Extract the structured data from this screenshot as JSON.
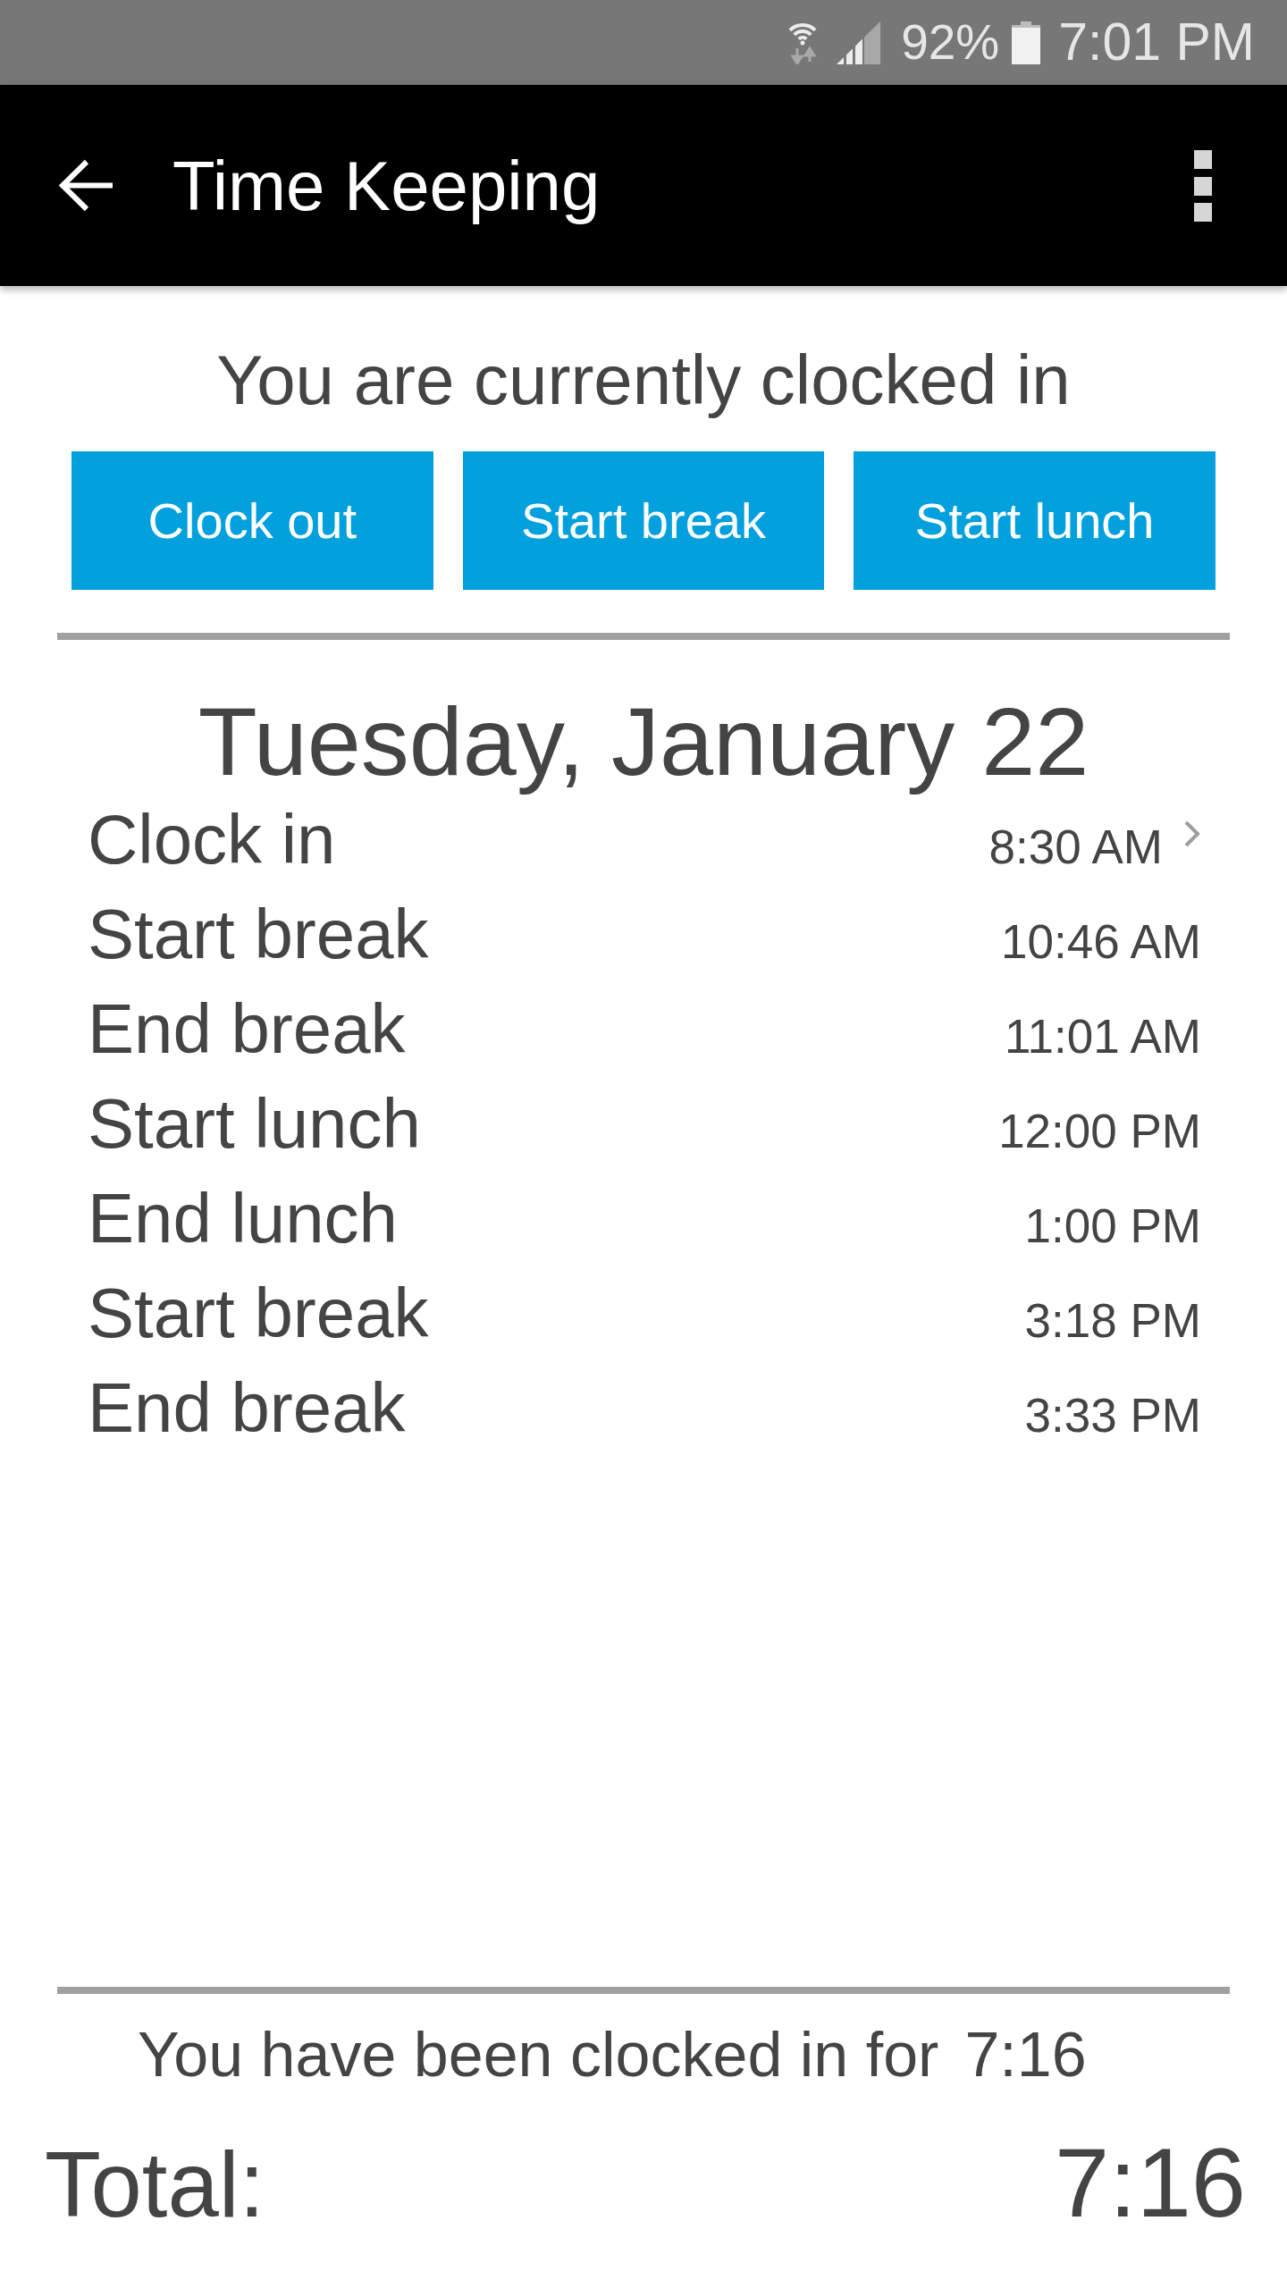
{
  "status_bar": {
    "battery": "92%",
    "time": "7:01 PM"
  },
  "app_bar": {
    "title": "Time Keeping"
  },
  "status_message": "You are currently clocked in",
  "actions": [
    {
      "label": "Clock out"
    },
    {
      "label": "Start break"
    },
    {
      "label": "Start lunch"
    }
  ],
  "day": {
    "title": "Tuesday, January 22",
    "entries": [
      {
        "label": "Clock in",
        "time": "8:30 AM",
        "disclosure": true
      },
      {
        "label": "Start break",
        "time": "10:46 AM",
        "disclosure": false
      },
      {
        "label": "End break",
        "time": "11:01 AM",
        "disclosure": false
      },
      {
        "label": "Start lunch",
        "time": "12:00 PM",
        "disclosure": false
      },
      {
        "label": "End lunch",
        "time": "1:00 PM",
        "disclosure": false
      },
      {
        "label": "Start break",
        "time": "3:18 PM",
        "disclosure": false
      },
      {
        "label": "End break",
        "time": "3:33 PM",
        "disclosure": false
      }
    ]
  },
  "summary": {
    "label": "You have been clocked in for",
    "duration": "7:16"
  },
  "total": {
    "label": "Total:",
    "value": "7:16"
  }
}
